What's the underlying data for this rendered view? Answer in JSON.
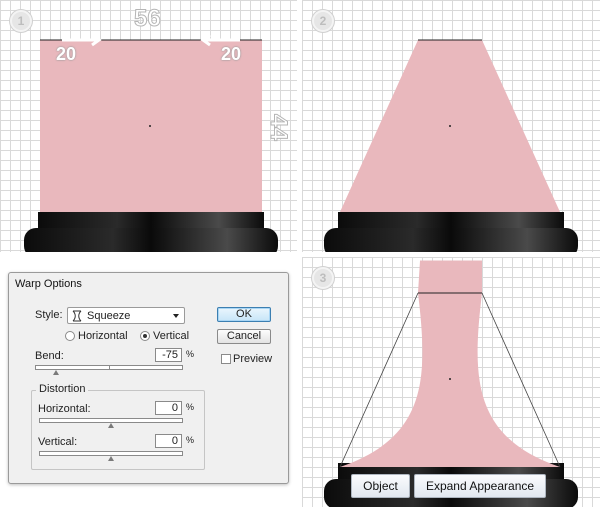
{
  "steps": [
    "1",
    "2",
    "3"
  ],
  "step1": {
    "top_width": "56",
    "left_inset": "20",
    "right_inset": "20",
    "height": "44"
  },
  "warp_dialog": {
    "title": "Warp Options",
    "style_label": "Style:",
    "style_value": "Squeeze",
    "horizontal_label": "Horizontal",
    "vertical_label": "Vertical",
    "orientation_selected": "Vertical",
    "bend_label": "Bend:",
    "bend_value": "-75",
    "percent": "%",
    "distortion_label": "Distortion",
    "dist_horizontal_label": "Horizontal:",
    "dist_horizontal_value": "0",
    "dist_vertical_label": "Vertical:",
    "dist_vertical_value": "0",
    "ok_label": "OK",
    "cancel_label": "Cancel",
    "preview_label": "Preview",
    "preview_checked": false,
    "bend_slider_level_percent": -75,
    "dist_h_slider_level_percent": 0,
    "dist_v_slider_level_percent": 0
  },
  "context_bar": {
    "object_label": "Object",
    "expand_label": "Expand Appearance"
  },
  "colors": {
    "shape_fill": "#e9b8bd",
    "base_dark": "#111111",
    "grid_line": "#d9d9d9",
    "primary_button_border": "#3c7fb1"
  }
}
